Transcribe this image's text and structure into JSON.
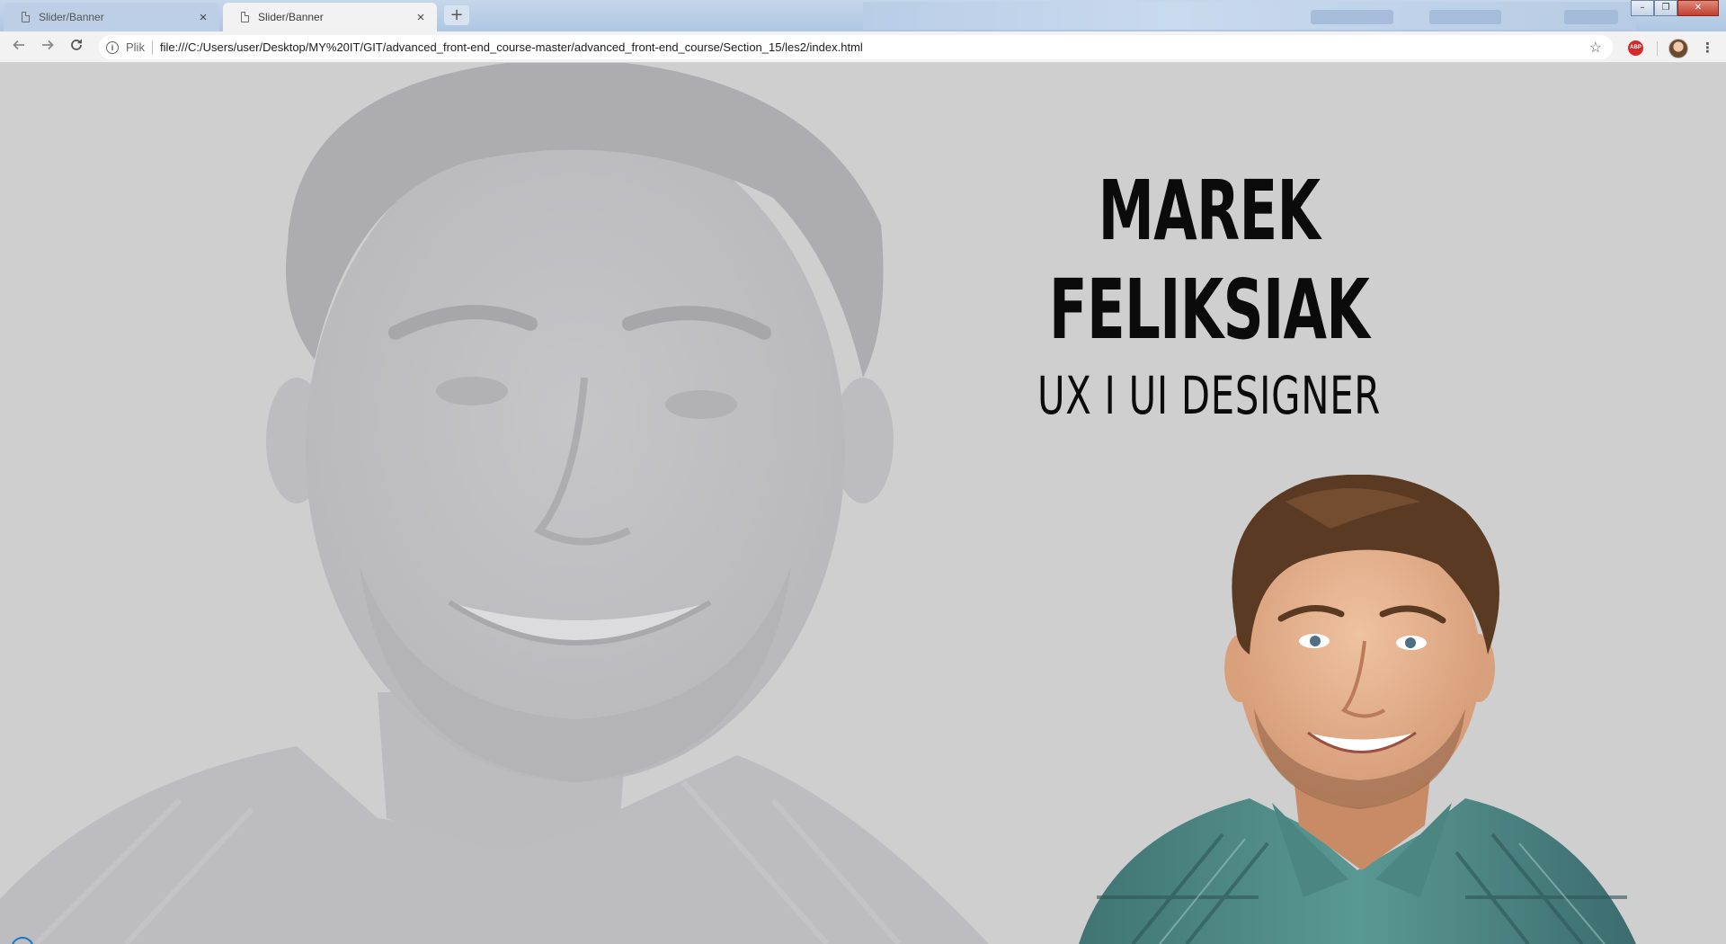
{
  "browser": {
    "tabs": [
      {
        "title": "Slider/Banner",
        "active": false
      },
      {
        "title": "Slider/Banner",
        "active": true
      }
    ],
    "new_tab_symbol": "+",
    "close_symbol": "×",
    "window_controls": {
      "minimize": "–",
      "maximize": "❐",
      "close": "✕"
    },
    "nav": {
      "back_icon": "arrow-left-icon",
      "forward_icon": "arrow-right-icon",
      "reload_icon": "reload-icon"
    },
    "address": {
      "scheme_label": "Plik",
      "url": "file:///C:/Users/user/Desktop/MY%20IT/GIT/advanced_front-end_course-master/advanced_front-end_course/Section_15/les2/index.html"
    },
    "extension_label": "ABP"
  },
  "hero": {
    "name": "MAREK FELIKSIAK",
    "role": "UX I UI DESIGNER"
  },
  "colors": {
    "page_background": "#cfcfcf",
    "heading_text": "#0b0b0b",
    "shirt_teal": "#4f8a87",
    "tab_strip": "#b7cbe4"
  }
}
